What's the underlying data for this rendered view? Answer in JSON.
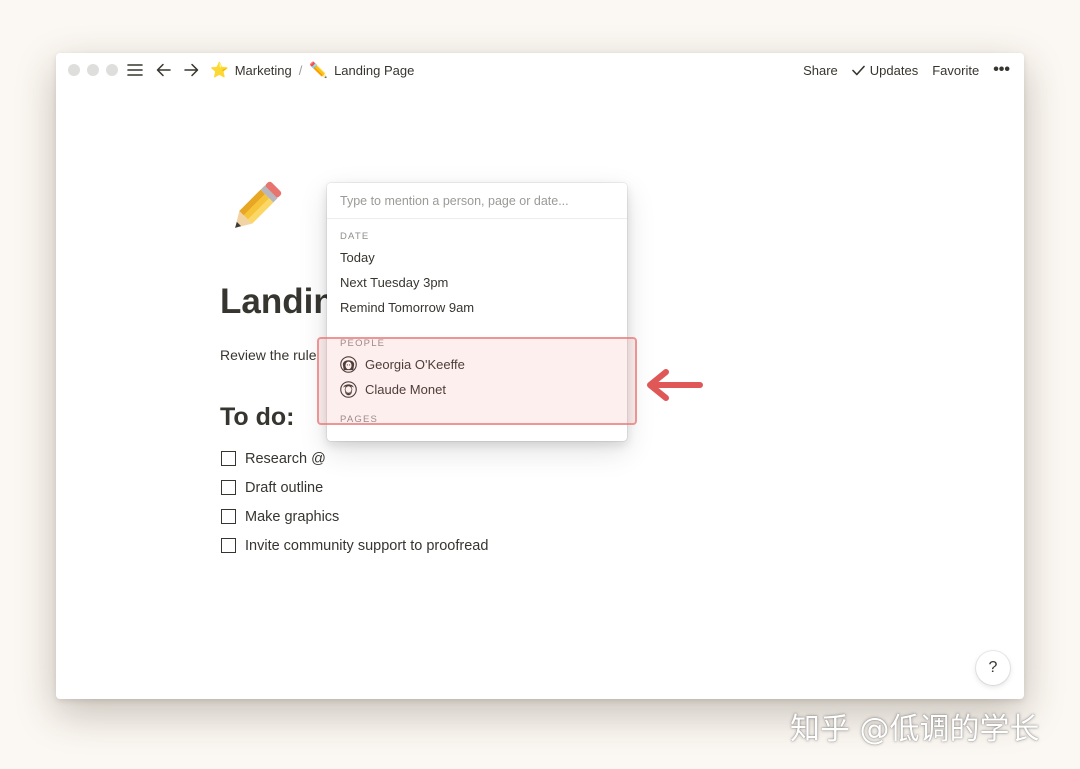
{
  "topbar": {
    "breadcrumb": [
      {
        "emoji": "⭐",
        "label": "Marketing"
      },
      {
        "emoji": "✏️",
        "label": "Landing Page"
      }
    ],
    "separator": "/",
    "share_label": "Share",
    "updates_label": "Updates",
    "favorite_label": "Favorite",
    "more_label": "•••"
  },
  "page": {
    "icon": "pencil-emoji",
    "title": "Landin",
    "description": "Review the rule",
    "todo_heading": "To do:",
    "todos": [
      {
        "label": "Research @",
        "checked": false
      },
      {
        "label": "Draft outline",
        "checked": false
      },
      {
        "label": "Make graphics",
        "checked": false
      },
      {
        "label": "Invite community support to proofread",
        "checked": false
      }
    ]
  },
  "mention_menu": {
    "placeholder": "Type to mention a person, page or date...",
    "date_label": "DATE",
    "date_items": [
      "Today",
      "Next Tuesday 3pm",
      "Remind Tomorrow 9am"
    ],
    "people_label": "PEOPLE",
    "people": [
      {
        "name": "Georgia O'Keeffe",
        "avatar": "georgia-avatar"
      },
      {
        "name": "Claude Monet",
        "avatar": "claude-avatar"
      }
    ],
    "pages_label": "PAGES"
  },
  "help_label": "?",
  "watermark": "知乎 @低调的学长",
  "colors": {
    "background": "#fbf7f2",
    "text": "#37352f",
    "highlight": "#e87878",
    "arrow": "#e05757"
  }
}
